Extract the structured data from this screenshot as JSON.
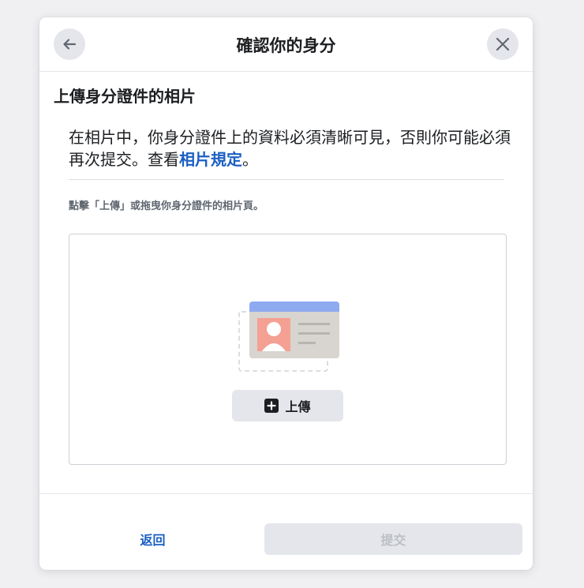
{
  "header": {
    "title": "確認你的身分",
    "back_icon": "arrow-left-icon",
    "close_icon": "close-icon"
  },
  "main": {
    "section_title": "上傳身分證件的相片",
    "description_text": "在相片中，你身分證件上的資料必須清晰可見，否則你可能必須再次提交。查看",
    "description_link": "相片規定",
    "description_end": "。",
    "instruction": "點擊「上傳」或拖曳你身分證件的相片頁。",
    "upload_button_label": "上傳",
    "upload_icon": "plus-square-icon"
  },
  "footer": {
    "back_label": "返回",
    "submit_label": "提交"
  },
  "colors": {
    "link": "#1b5fc4",
    "button_bg": "#e4e6eb",
    "disabled_text": "#bcc0c4"
  }
}
